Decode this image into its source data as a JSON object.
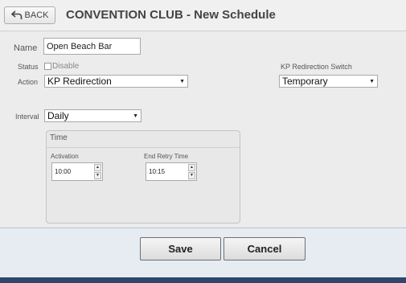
{
  "header": {
    "back_label": "BACK",
    "title": "CONVENTION CLUB - New Schedule"
  },
  "form": {
    "name_label": "Name",
    "name_value": "Open Beach Bar",
    "status_label": "Status",
    "disable_label": "Disable",
    "disable_checked": false,
    "action_label": "Action",
    "action_value": "KP Redirection",
    "kp_switch_label": "KP Redirection Switch",
    "kp_switch_value": "Temporary",
    "interval_label": "Interval",
    "interval_value": "Daily"
  },
  "time": {
    "legend": "Time",
    "activation_label": "Activation",
    "activation_value": "10:00",
    "end_retry_label": "End Retry Time",
    "end_retry_value": "10:15"
  },
  "footer": {
    "save_label": "Save",
    "cancel_label": "Cancel"
  },
  "icons": {
    "back": "back-arrow-icon",
    "dropdown": "chevron-down-icon",
    "spin_up": "spin-up-icon",
    "spin_down": "spin-down-icon"
  },
  "colors": {
    "bottom_bar": "#30466b",
    "footer_bg": "#e6ecf2"
  }
}
